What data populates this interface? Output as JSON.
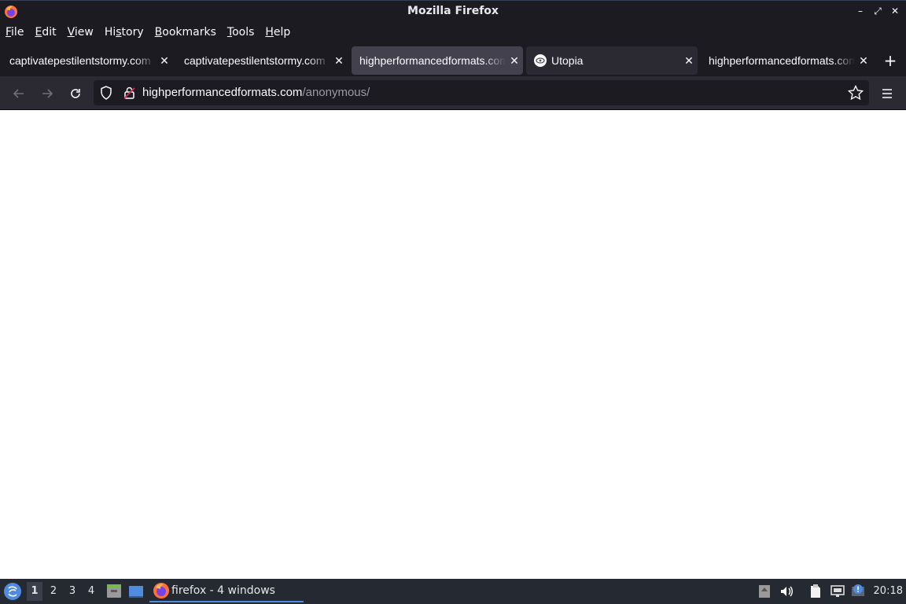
{
  "window": {
    "title": "Mozilla Firefox"
  },
  "menubar": [
    {
      "pre": "",
      "u": "F",
      "post": "ile"
    },
    {
      "pre": "",
      "u": "E",
      "post": "dit"
    },
    {
      "pre": "",
      "u": "V",
      "post": "iew"
    },
    {
      "pre": "Hi",
      "u": "s",
      "post": "tory"
    },
    {
      "pre": "",
      "u": "B",
      "post": "ookmarks"
    },
    {
      "pre": "",
      "u": "T",
      "post": "ools"
    },
    {
      "pre": "",
      "u": "H",
      "post": "elp"
    }
  ],
  "tabs": [
    {
      "label": "captivatepestilentstormy.com",
      "state": "normal"
    },
    {
      "label": "captivatepestilentstormy.com",
      "state": "normal"
    },
    {
      "label": "highperformancedformats.com",
      "state": "selected"
    },
    {
      "label": "Utopia",
      "state": "hover"
    },
    {
      "label": "highperformancedformats.com",
      "state": "normal"
    }
  ],
  "urlbar": {
    "host": "highperformancedformats.com",
    "path": "/anonymous/"
  },
  "taskbar": {
    "workspaces": [
      "1",
      "2",
      "3",
      "4"
    ],
    "active_workspace": "1",
    "task_label": "firefox - 4 windows",
    "clock": "20:18"
  },
  "colors": {
    "accent": "#4f8ce0",
    "toolbar": "#2b2a33",
    "frame": "#1c1b22"
  }
}
